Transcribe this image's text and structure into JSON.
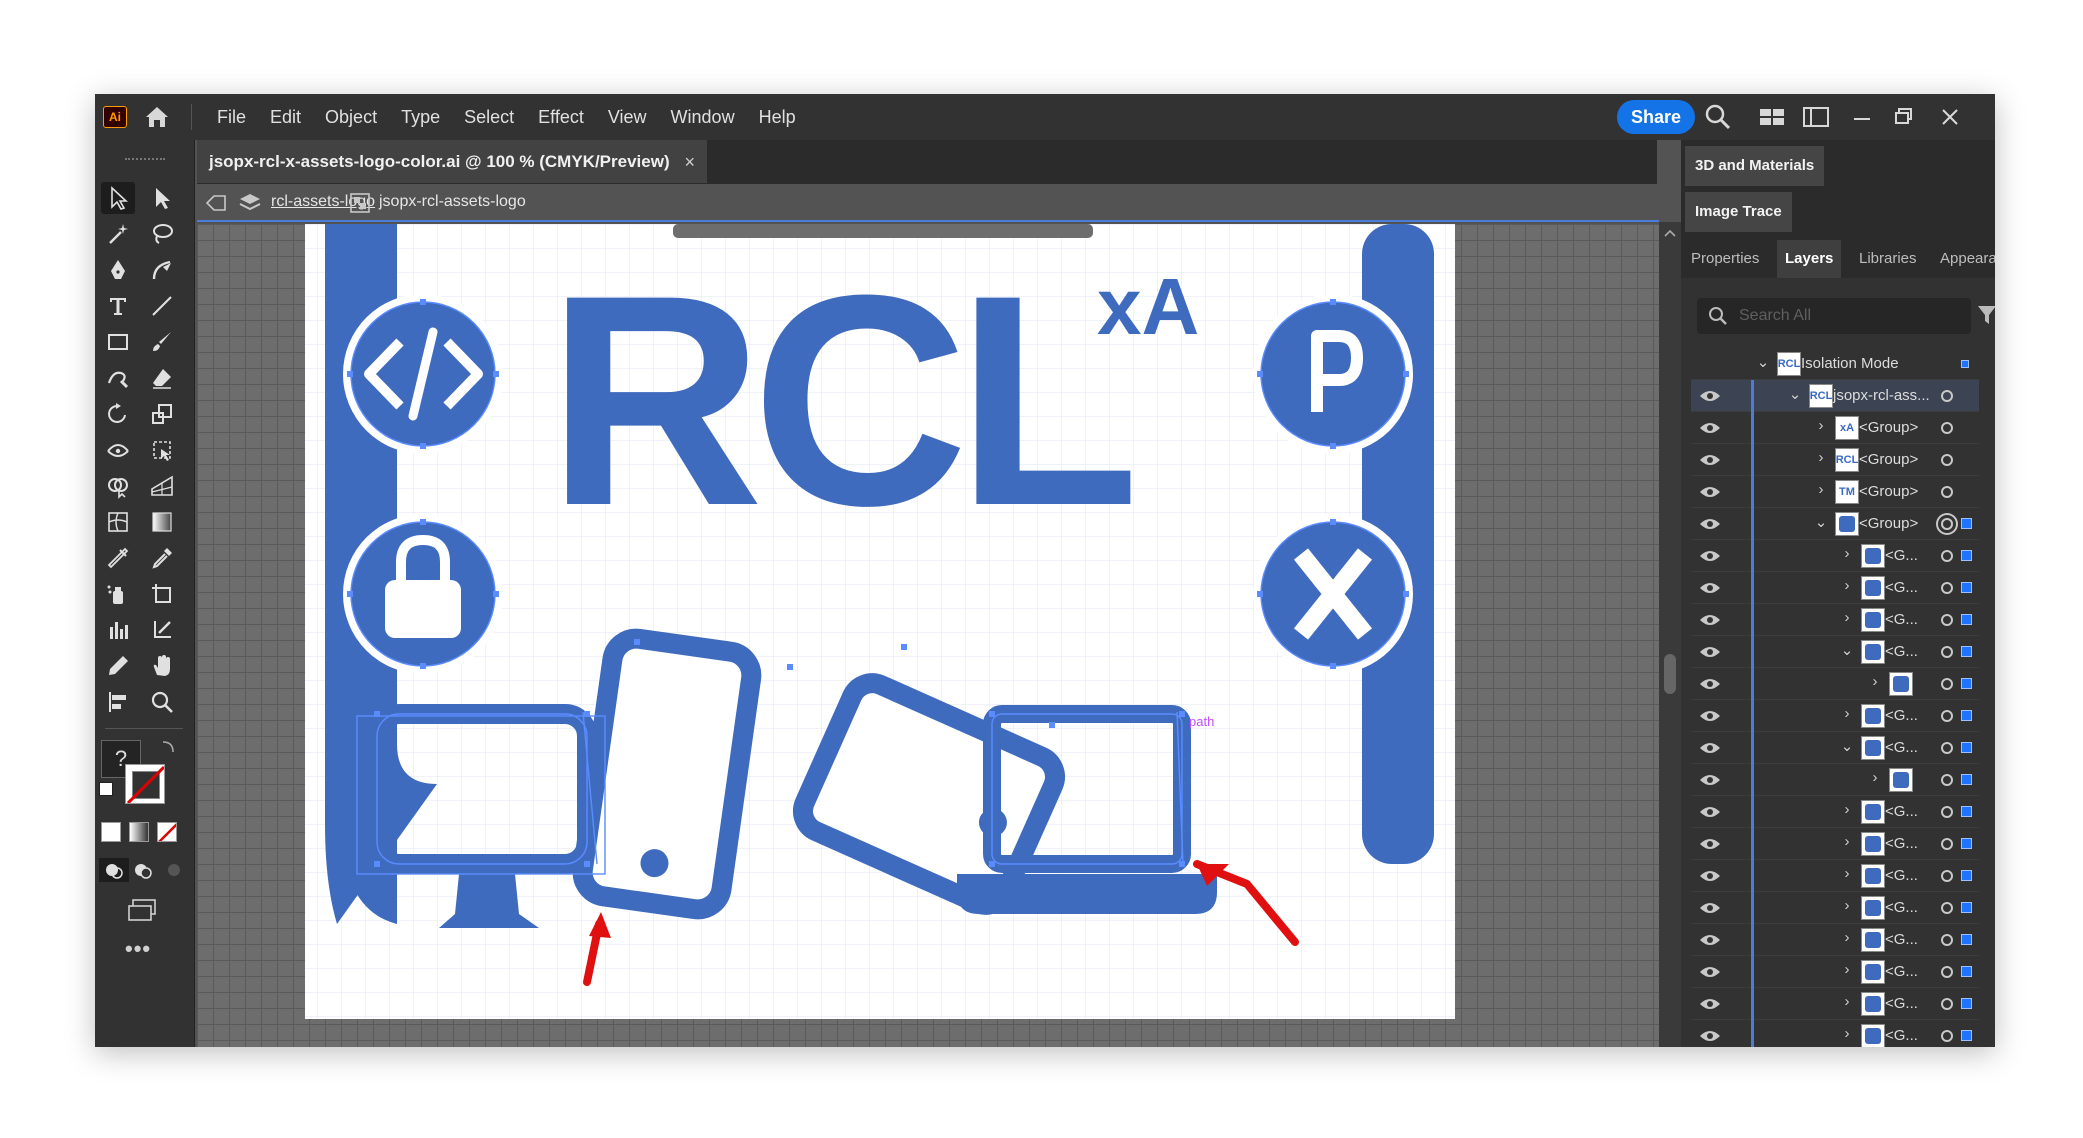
{
  "app": {
    "logo": "Ai",
    "home_icon": "home-icon"
  },
  "menu": [
    "File",
    "Edit",
    "Object",
    "Type",
    "Select",
    "Effect",
    "View",
    "Window",
    "Help"
  ],
  "topbar": {
    "share_label": "Share"
  },
  "document": {
    "tab_title": "jsopx-rcl-x-assets-logo-color.ai @ 100 % (CMYK/Preview)",
    "close_label": "×"
  },
  "isolation": {
    "crumb_layer": "rcl-assets-logo",
    "crumb_group": "jsopx-rcl-assets-logo"
  },
  "artwork": {
    "title": "RCL",
    "superscript": "xA",
    "path_label": "path",
    "primary_color": "#3f6bbf",
    "arrow_color": "#e01010"
  },
  "tools": {
    "color_help": "?"
  },
  "panels": {
    "section_3d": "3D and Materials",
    "section_trace": "Image Trace",
    "tabs": [
      "Properties",
      "Layers",
      "Libraries",
      "Appearance"
    ],
    "active_tab": "Layers",
    "search_placeholder": "Search All"
  },
  "layers": [
    {
      "name": "Isolation Mode",
      "thumb": "RCL",
      "level": 0,
      "chevron": "down"
    },
    {
      "name": "jsopx-rcl-ass...",
      "thumb": "RCL",
      "level": 1,
      "chevron": "down"
    },
    {
      "name": "<Group>",
      "thumb": "xA",
      "level": 2,
      "chevron": "right"
    },
    {
      "name": "<Group>",
      "thumb": "RCL",
      "level": 2,
      "chevron": "right"
    },
    {
      "name": "<Group>",
      "thumb": "TM",
      "level": 2,
      "chevron": "right"
    },
    {
      "name": "<Group>",
      "thumb": "",
      "level": 2,
      "chevron": "down"
    },
    {
      "name": "<G...",
      "thumb": "",
      "level": 3,
      "chevron": "right"
    },
    {
      "name": "<G...",
      "thumb": "",
      "level": 3,
      "chevron": "right"
    },
    {
      "name": "<G...",
      "thumb": "",
      "level": 3,
      "chevron": "right"
    },
    {
      "name": "<G...",
      "thumb": "",
      "level": 3,
      "chevron": "down"
    },
    {
      "name": "",
      "thumb": "",
      "level": 4,
      "chevron": "right"
    },
    {
      "name": "<G...",
      "thumb": "",
      "level": 3,
      "chevron": "right"
    },
    {
      "name": "<G...",
      "thumb": "",
      "level": 3,
      "chevron": "down"
    },
    {
      "name": "",
      "thumb": "",
      "level": 4,
      "chevron": "right"
    },
    {
      "name": "<G...",
      "thumb": "",
      "level": 3,
      "chevron": "right"
    },
    {
      "name": "<G...",
      "thumb": "",
      "level": 3,
      "chevron": "right"
    },
    {
      "name": "<G...",
      "thumb": "",
      "level": 3,
      "chevron": "right"
    },
    {
      "name": "<G...",
      "thumb": "",
      "level": 3,
      "chevron": "right"
    },
    {
      "name": "<G...",
      "thumb": "",
      "level": 3,
      "chevron": "right"
    },
    {
      "name": "<G...",
      "thumb": "",
      "level": 3,
      "chevron": "right"
    },
    {
      "name": "<G...",
      "thumb": "",
      "level": 3,
      "chevron": "right"
    },
    {
      "name": "<G...",
      "thumb": "",
      "level": 3,
      "chevron": "right"
    }
  ]
}
